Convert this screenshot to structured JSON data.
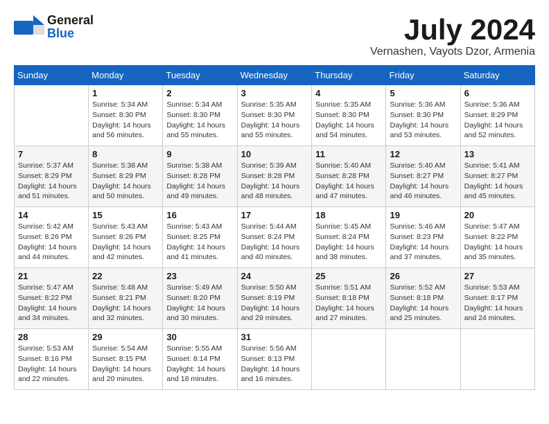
{
  "header": {
    "logo_general": "General",
    "logo_blue": "Blue",
    "month_title": "July 2024",
    "subtitle": "Vernashen, Vayots Dzor, Armenia"
  },
  "days_of_week": [
    "Sunday",
    "Monday",
    "Tuesday",
    "Wednesday",
    "Thursday",
    "Friday",
    "Saturday"
  ],
  "weeks": [
    [
      {
        "date": "",
        "info": ""
      },
      {
        "date": "1",
        "info": "Sunrise: 5:34 AM\nSunset: 8:30 PM\nDaylight: 14 hours\nand 56 minutes."
      },
      {
        "date": "2",
        "info": "Sunrise: 5:34 AM\nSunset: 8:30 PM\nDaylight: 14 hours\nand 55 minutes."
      },
      {
        "date": "3",
        "info": "Sunrise: 5:35 AM\nSunset: 8:30 PM\nDaylight: 14 hours\nand 55 minutes."
      },
      {
        "date": "4",
        "info": "Sunrise: 5:35 AM\nSunset: 8:30 PM\nDaylight: 14 hours\nand 54 minutes."
      },
      {
        "date": "5",
        "info": "Sunrise: 5:36 AM\nSunset: 8:30 PM\nDaylight: 14 hours\nand 53 minutes."
      },
      {
        "date": "6",
        "info": "Sunrise: 5:36 AM\nSunset: 8:29 PM\nDaylight: 14 hours\nand 52 minutes."
      }
    ],
    [
      {
        "date": "7",
        "info": "Sunrise: 5:37 AM\nSunset: 8:29 PM\nDaylight: 14 hours\nand 51 minutes."
      },
      {
        "date": "8",
        "info": "Sunrise: 5:38 AM\nSunset: 8:29 PM\nDaylight: 14 hours\nand 50 minutes."
      },
      {
        "date": "9",
        "info": "Sunrise: 5:38 AM\nSunset: 8:28 PM\nDaylight: 14 hours\nand 49 minutes."
      },
      {
        "date": "10",
        "info": "Sunrise: 5:39 AM\nSunset: 8:28 PM\nDaylight: 14 hours\nand 48 minutes."
      },
      {
        "date": "11",
        "info": "Sunrise: 5:40 AM\nSunset: 8:28 PM\nDaylight: 14 hours\nand 47 minutes."
      },
      {
        "date": "12",
        "info": "Sunrise: 5:40 AM\nSunset: 8:27 PM\nDaylight: 14 hours\nand 46 minutes."
      },
      {
        "date": "13",
        "info": "Sunrise: 5:41 AM\nSunset: 8:27 PM\nDaylight: 14 hours\nand 45 minutes."
      }
    ],
    [
      {
        "date": "14",
        "info": "Sunrise: 5:42 AM\nSunset: 8:26 PM\nDaylight: 14 hours\nand 44 minutes."
      },
      {
        "date": "15",
        "info": "Sunrise: 5:43 AM\nSunset: 8:26 PM\nDaylight: 14 hours\nand 42 minutes."
      },
      {
        "date": "16",
        "info": "Sunrise: 5:43 AM\nSunset: 8:25 PM\nDaylight: 14 hours\nand 41 minutes."
      },
      {
        "date": "17",
        "info": "Sunrise: 5:44 AM\nSunset: 8:24 PM\nDaylight: 14 hours\nand 40 minutes."
      },
      {
        "date": "18",
        "info": "Sunrise: 5:45 AM\nSunset: 8:24 PM\nDaylight: 14 hours\nand 38 minutes."
      },
      {
        "date": "19",
        "info": "Sunrise: 5:46 AM\nSunset: 8:23 PM\nDaylight: 14 hours\nand 37 minutes."
      },
      {
        "date": "20",
        "info": "Sunrise: 5:47 AM\nSunset: 8:22 PM\nDaylight: 14 hours\nand 35 minutes."
      }
    ],
    [
      {
        "date": "21",
        "info": "Sunrise: 5:47 AM\nSunset: 8:22 PM\nDaylight: 14 hours\nand 34 minutes."
      },
      {
        "date": "22",
        "info": "Sunrise: 5:48 AM\nSunset: 8:21 PM\nDaylight: 14 hours\nand 32 minutes."
      },
      {
        "date": "23",
        "info": "Sunrise: 5:49 AM\nSunset: 8:20 PM\nDaylight: 14 hours\nand 30 minutes."
      },
      {
        "date": "24",
        "info": "Sunrise: 5:50 AM\nSunset: 8:19 PM\nDaylight: 14 hours\nand 29 minutes."
      },
      {
        "date": "25",
        "info": "Sunrise: 5:51 AM\nSunset: 8:18 PM\nDaylight: 14 hours\nand 27 minutes."
      },
      {
        "date": "26",
        "info": "Sunrise: 5:52 AM\nSunset: 8:18 PM\nDaylight: 14 hours\nand 25 minutes."
      },
      {
        "date": "27",
        "info": "Sunrise: 5:53 AM\nSunset: 8:17 PM\nDaylight: 14 hours\nand 24 minutes."
      }
    ],
    [
      {
        "date": "28",
        "info": "Sunrise: 5:53 AM\nSunset: 8:16 PM\nDaylight: 14 hours\nand 22 minutes."
      },
      {
        "date": "29",
        "info": "Sunrise: 5:54 AM\nSunset: 8:15 PM\nDaylight: 14 hours\nand 20 minutes."
      },
      {
        "date": "30",
        "info": "Sunrise: 5:55 AM\nSunset: 8:14 PM\nDaylight: 14 hours\nand 18 minutes."
      },
      {
        "date": "31",
        "info": "Sunrise: 5:56 AM\nSunset: 8:13 PM\nDaylight: 14 hours\nand 16 minutes."
      },
      {
        "date": "",
        "info": ""
      },
      {
        "date": "",
        "info": ""
      },
      {
        "date": "",
        "info": ""
      }
    ]
  ]
}
